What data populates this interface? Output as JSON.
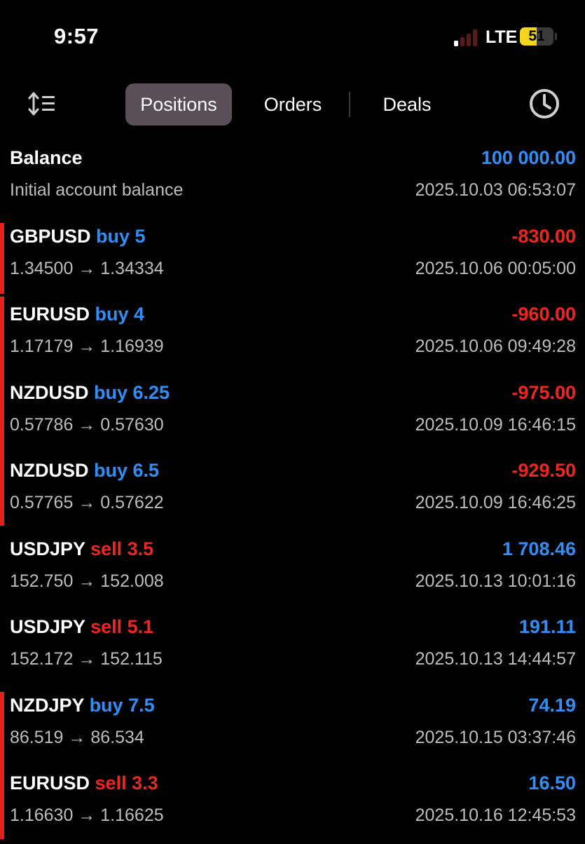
{
  "status_bar": {
    "time": "9:57",
    "network": "LTE",
    "battery": "51",
    "battery_level": 0.51
  },
  "toolbar": {
    "tabs": [
      {
        "label": "Positions",
        "active": true
      },
      {
        "label": "Orders",
        "active": false
      },
      {
        "label": "Deals",
        "active": false
      }
    ],
    "icons": {
      "left": "sort-icon",
      "right": "history-clock-icon"
    }
  },
  "balance": {
    "title": "Balance",
    "description": "Initial account balance",
    "amount": "100 000.00",
    "timestamp": "2025.10.03 06:53:07"
  },
  "colors": {
    "profit": "#2f8ff6",
    "loss": "#f0261c",
    "buy": "#2f8ff6",
    "sell": "#f0261c",
    "accent_bar": "#e5201a"
  },
  "deals": [
    {
      "symbol": "GBPUSD",
      "side": "buy 5",
      "prices": "1.34500 → 1.34334",
      "profit": "-830.00",
      "time": "2025.10.06 00:05:00",
      "side_color": "blue",
      "profit_color": "red"
    },
    {
      "symbol": "EURUSD",
      "side": "buy 4",
      "prices": "1.17179 → 1.16939",
      "profit": "-960.00",
      "time": "2025.10.06 09:49:28",
      "side_color": "blue",
      "profit_color": "red"
    },
    {
      "symbol": "NZDUSD",
      "side": "buy 6.25",
      "prices": "0.57786 → 0.57630",
      "profit": "-975.00",
      "time": "2025.10.09 16:46:15",
      "side_color": "blue",
      "profit_color": "red"
    },
    {
      "symbol": "NZDUSD",
      "side": "buy 6.5",
      "prices": "0.57765 → 0.57622",
      "profit": "-929.50",
      "time": "2025.10.09 16:46:25",
      "side_color": "blue",
      "profit_color": "red"
    },
    {
      "symbol": "USDJPY",
      "side": "sell 3.5",
      "prices": "152.750 → 152.008",
      "profit": "1 708.46",
      "time": "2025.10.13 10:01:16",
      "side_color": "red",
      "profit_color": "blue"
    },
    {
      "symbol": "USDJPY",
      "side": "sell 5.1",
      "prices": "152.172 → 152.115",
      "profit": "191.11",
      "time": "2025.10.13 14:44:57",
      "side_color": "red",
      "profit_color": "blue"
    },
    {
      "symbol": "NZDJPY",
      "side": "buy 7.5",
      "prices": "86.519 → 86.534",
      "profit": "74.19",
      "time": "2025.10.15 03:37:46",
      "side_color": "blue",
      "profit_color": "blue"
    },
    {
      "symbol": "EURUSD",
      "side": "sell 3.3",
      "prices": "1.16630 → 1.16625",
      "profit": "16.50",
      "time": "2025.10.16 12:45:53",
      "side_color": "red",
      "profit_color": "blue"
    }
  ]
}
